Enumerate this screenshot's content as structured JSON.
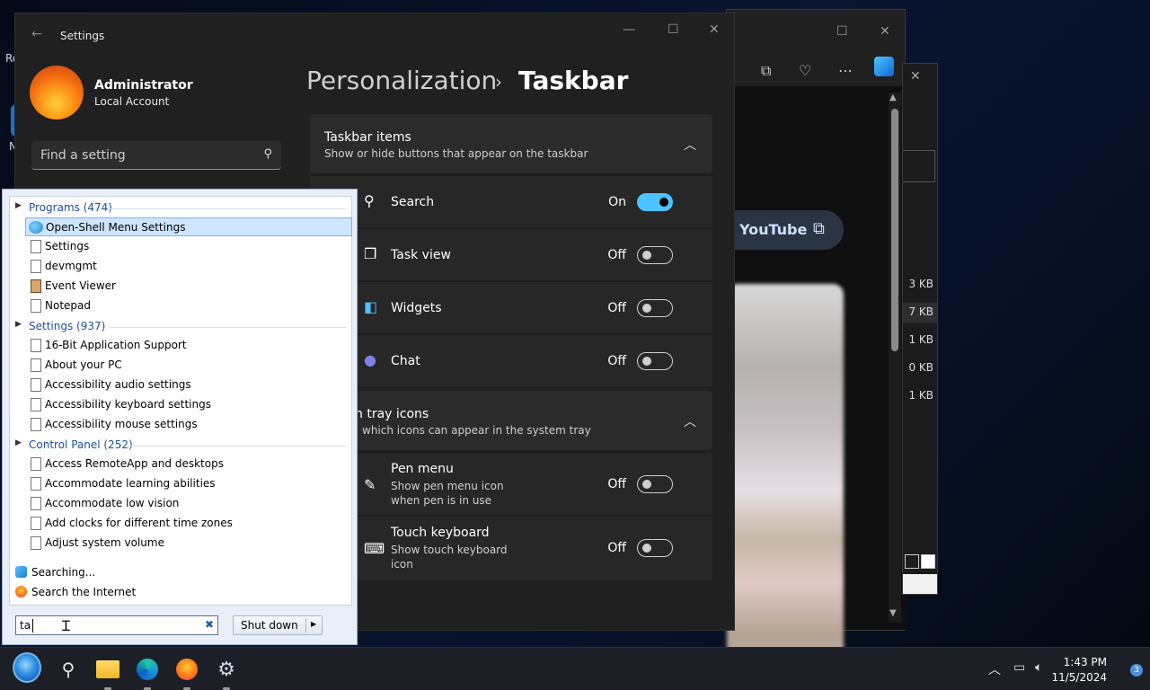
{
  "settings": {
    "title": "Settings",
    "user": {
      "name": "Administrator",
      "account": "Local Account"
    },
    "find_placeholder": "Find a setting",
    "breadcrumb": {
      "parent": "Personalization",
      "current": "Taskbar"
    },
    "taskbar_items": {
      "title": "Taskbar items",
      "subtitle": "Show or hide buttons that appear on the taskbar",
      "rows": [
        {
          "label": "Search",
          "state": "On",
          "on": true,
          "icon": "search-icon"
        },
        {
          "label": "Task view",
          "state": "Off",
          "on": false,
          "icon": "task-view-icon"
        },
        {
          "label": "Widgets",
          "state": "Off",
          "on": false,
          "icon": "widgets-icon"
        },
        {
          "label": "Chat",
          "state": "Off",
          "on": false,
          "icon": "chat-icon"
        }
      ]
    },
    "tray_icons": {
      "title": "n tray icons",
      "subtitle": "which icons can appear in the system tray",
      "rows": [
        {
          "label": "Pen menu",
          "sub1": "Show pen menu icon",
          "sub2": "when pen is in use",
          "state": "Off"
        },
        {
          "label": "Touch keyboard",
          "sub1": "Show touch keyboard",
          "sub2": "icon",
          "state": "Off"
        }
      ]
    }
  },
  "browser": {
    "youtube_label": "YouTube"
  },
  "explorer": {
    "sizes": [
      "3 KB",
      "7 KB",
      "1 KB",
      "0 KB",
      "1 KB"
    ]
  },
  "start_menu": {
    "programs_header": "Programs (474)",
    "programs": [
      "Open-Shell Menu Settings",
      "Settings",
      "devmgmt",
      "Event Viewer",
      "Notepad"
    ],
    "settings_header": "Settings (937)",
    "settings_items": [
      "16-Bit Application Support",
      "About your PC",
      "Accessibility audio settings",
      "Accessibility keyboard settings",
      "Accessibility mouse settings"
    ],
    "control_header": "Control Panel (252)",
    "control_items": [
      "Access RemoteApp and desktops",
      "Accommodate learning abilities",
      "Accommodate low vision",
      "Add clocks for different time zones",
      "Adjust system volume"
    ],
    "searching": "Searching...",
    "search_internet": "Search the Internet",
    "search_value": "ta",
    "shutdown": "Shut down"
  },
  "taskbar": {
    "time": "1:43 PM",
    "date": "11/5/2024",
    "notification_count": "3"
  },
  "desktop": {
    "glyph1": "Re",
    "glyph2": "N"
  }
}
